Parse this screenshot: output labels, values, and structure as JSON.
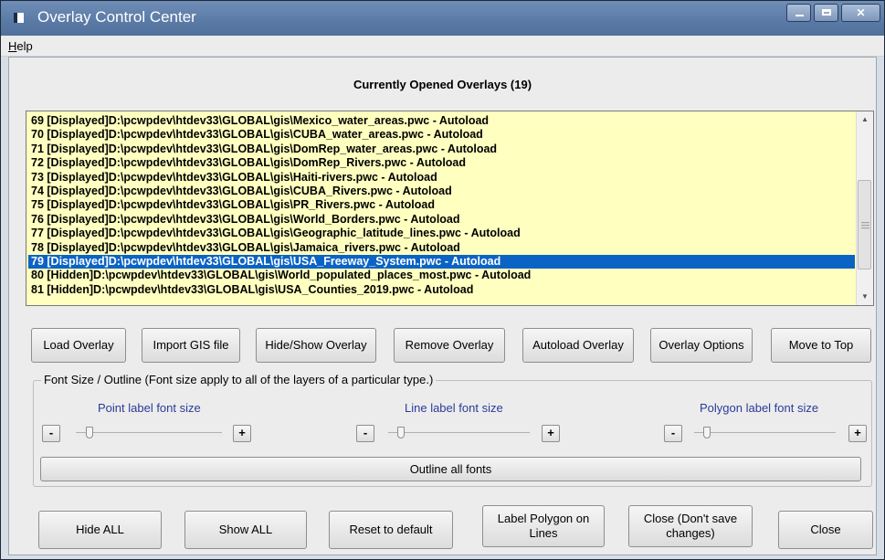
{
  "window": {
    "title": "Overlay Control Center"
  },
  "menu": {
    "help": "Help",
    "help_rest": "elp",
    "help_mnemonic": "H"
  },
  "heading": "Currently Opened Overlays (19)",
  "overlays": [
    "69 [Displayed]D:\\pcwpdev\\htdev33\\GLOBAL\\gis\\Mexico_water_areas.pwc - Autoload",
    "70 [Displayed]D:\\pcwpdev\\htdev33\\GLOBAL\\gis\\CUBA_water_areas.pwc - Autoload",
    "71 [Displayed]D:\\pcwpdev\\htdev33\\GLOBAL\\gis\\DomRep_water_areas.pwc - Autoload",
    "72 [Displayed]D:\\pcwpdev\\htdev33\\GLOBAL\\gis\\DomRep_Rivers.pwc - Autoload",
    "73 [Displayed]D:\\pcwpdev\\htdev33\\GLOBAL\\gis\\Haiti-rivers.pwc - Autoload",
    "74 [Displayed]D:\\pcwpdev\\htdev33\\GLOBAL\\gis\\CUBA_Rivers.pwc - Autoload",
    "75 [Displayed]D:\\pcwpdev\\htdev33\\GLOBAL\\gis\\PR_Rivers.pwc - Autoload",
    "76 [Displayed]D:\\pcwpdev\\htdev33\\GLOBAL\\gis\\World_Borders.pwc - Autoload",
    "77 [Displayed]D:\\pcwpdev\\htdev33\\GLOBAL\\gis\\Geographic_latitude_lines.pwc - Autoload",
    "78 [Displayed]D:\\pcwpdev\\htdev33\\GLOBAL\\gis\\Jamaica_rivers.pwc - Autoload",
    "79 [Displayed]D:\\pcwpdev\\htdev33\\GLOBAL\\gis\\USA_Freeway_System.pwc - Autoload",
    "80 [Hidden]D:\\pcwpdev\\htdev33\\GLOBAL\\gis\\World_populated_places_most.pwc - Autoload",
    "81 [Hidden]D:\\pcwpdev\\htdev33\\GLOBAL\\gis\\USA_Counties_2019.pwc - Autoload"
  ],
  "selected_index": 10,
  "buttons": {
    "load": "Load Overlay",
    "import": "Import GIS file",
    "hide_show": "Hide/Show Overlay",
    "remove": "Remove Overlay",
    "autoload": "Autoload Overlay",
    "options": "Overlay Options",
    "move_top": "Move to Top"
  },
  "font_group": {
    "legend": "Font Size / Outline  (Font size apply to all of the layers of a particular type.)",
    "point_label": "Point label font size",
    "line_label": "Line label font size",
    "polygon_label": "Polygon label font size",
    "minus": "-",
    "plus": "+",
    "outline_all": "Outline all fonts"
  },
  "bottom_buttons": {
    "hide_all": "Hide ALL",
    "show_all": "Show ALL",
    "reset": "Reset to default",
    "label_polygon": "Label Polygon on Lines",
    "close_nosave": "Close (Don't save changes)",
    "close": "Close"
  },
  "icons": [
    "app-icon",
    "minimize-icon",
    "maximize-icon",
    "close-icon",
    "scroll-up-icon",
    "scroll-down-icon"
  ],
  "colors": {
    "selection": "#0b63c5",
    "list_bg": "#ffffc0",
    "label_blue": "#2a3b9a",
    "title_bar": "#5a7aa6"
  }
}
